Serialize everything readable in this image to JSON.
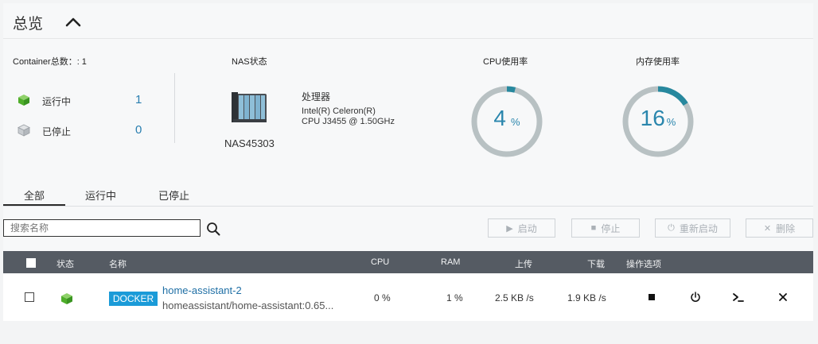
{
  "header": {
    "title": "总览"
  },
  "summary": {
    "container_total_label": "Container总数：: 1",
    "running_label": "运行中",
    "running_count": "1",
    "stopped_label": "已停止",
    "stopped_count": "0"
  },
  "nas": {
    "section_label": "NAS状态",
    "name": "NAS45303",
    "processor_label": "处理器",
    "processor_line1": "Intel(R) Celeron(R)",
    "processor_line2": "CPU J3455 @ 1.50GHz"
  },
  "cpu": {
    "label": "CPU使用率",
    "value": "4",
    "unit": "%",
    "percent": 4
  },
  "memory": {
    "label": "内存使用率",
    "value": "16",
    "unit": "%",
    "percent": 16
  },
  "colors": {
    "gauge_track": "#b8c1c3",
    "gauge_fill": "#27889e",
    "accent": "#2a7fb0",
    "docker_badge": "#1b9bd8"
  },
  "tabs": [
    {
      "label": "全部",
      "active": true
    },
    {
      "label": "运行中",
      "active": false
    },
    {
      "label": "已停止",
      "active": false
    }
  ],
  "search": {
    "placeholder": "搜索名称",
    "value": ""
  },
  "actions": {
    "start_label": "启动",
    "stop_label": "停止",
    "restart_label": "重新启动",
    "delete_label": "删除"
  },
  "table": {
    "columns": {
      "status": "状态",
      "name": "名称",
      "cpu": "CPU",
      "ram": "RAM",
      "upload": "上传",
      "download": "下载",
      "ops": "操作选项"
    },
    "rows": [
      {
        "badge": "DOCKER",
        "name": "home-assistant-2",
        "image": "homeassistant/home-assistant:0.65...",
        "cpu": "0 %",
        "ram": "1 %",
        "upload": "2.5 KB /s",
        "download": "1.9 KB /s"
      }
    ]
  }
}
